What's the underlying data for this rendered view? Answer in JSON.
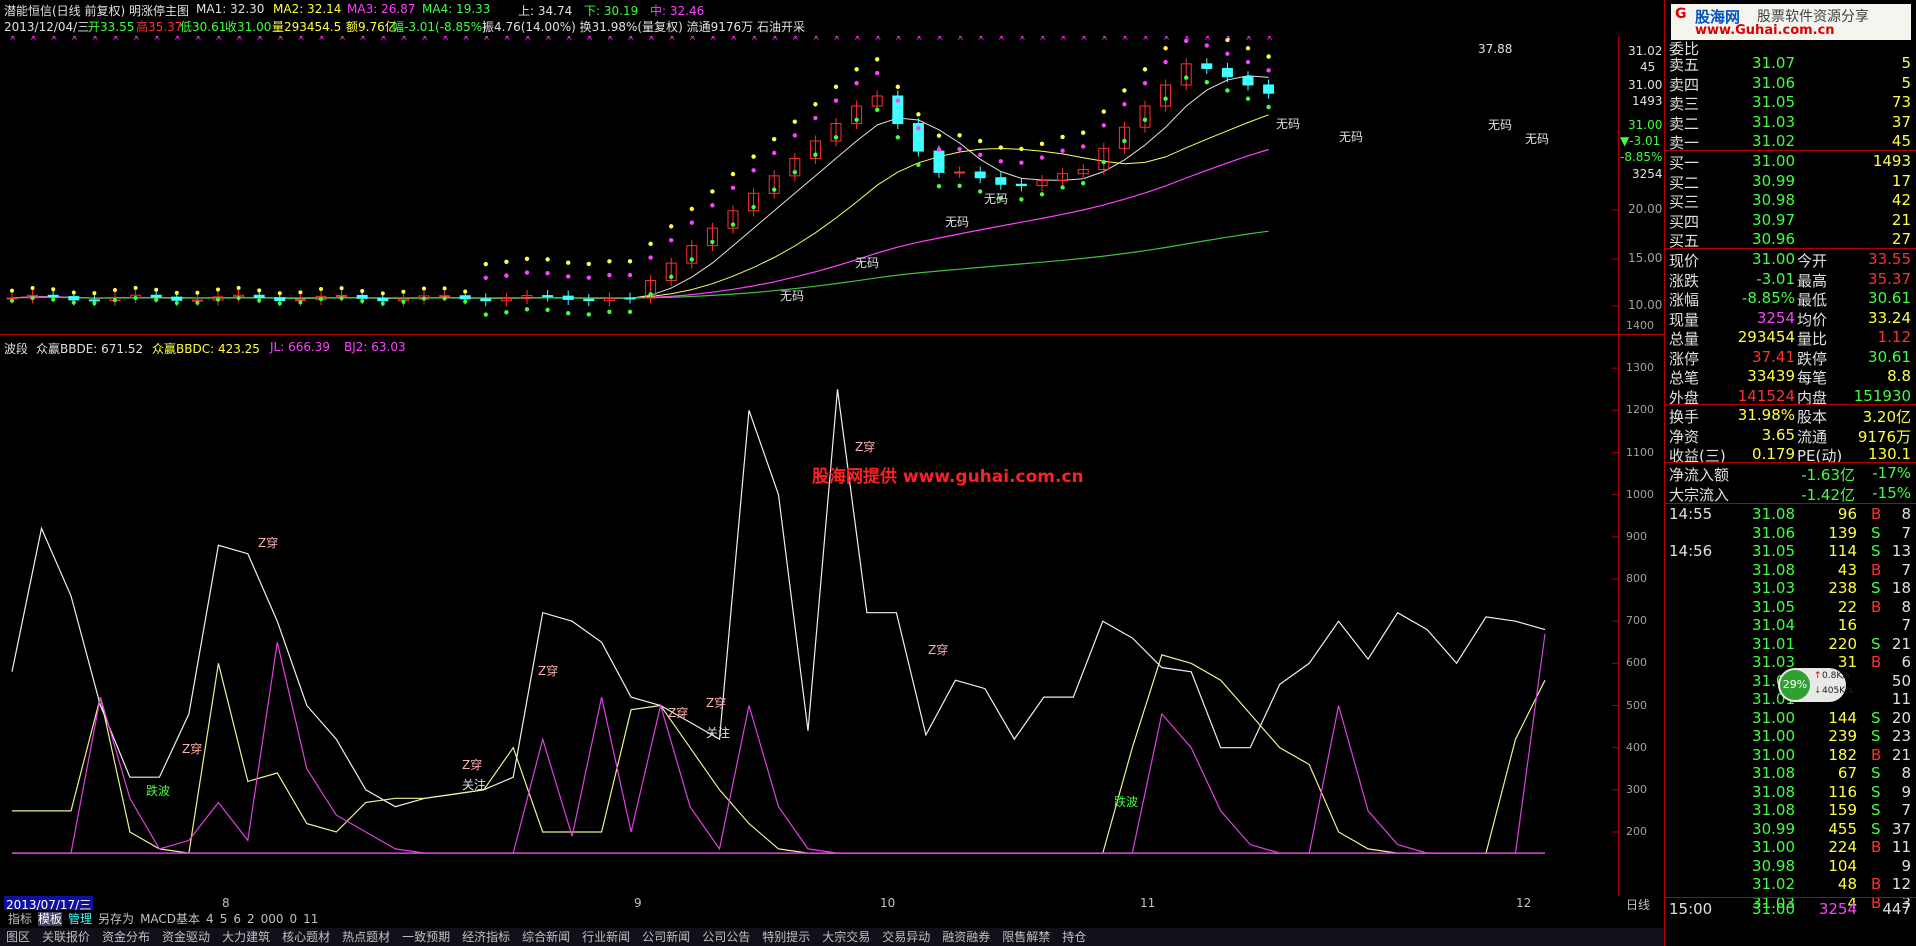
{
  "header": {
    "title": "潜能恒信(日线 前复权) 明涨停主图",
    "ma1": "MA1: 32.30",
    "ma2": "MA2: 32.14",
    "ma3": "MA3: 26.87",
    "ma4": "MA4: 19.33",
    "up": "上: 34.74",
    "down": "下: 30.19",
    "mid": "中: 32.46",
    "info_line": "2013/12/04/三",
    "open": "开33.55",
    "high": "高35.37",
    "low": "低30.61",
    "close": "收31.00",
    "vol": "量293454.5",
    "amt": "额9.76亿",
    "chg": "幅-3.01(-8.85%)",
    "extra": "振4.76(14.00%) 换31.98%(量复权) 流通9176万 石油开采"
  },
  "main_chart": {
    "price_labels": [
      "31.02",
      "45",
      "31.00",
      "1493",
      "31.00",
      "▼-3.01",
      "-8.85%",
      "3254",
      "20.00",
      "15.00",
      "10.00"
    ],
    "peak_label": "37.88",
    "annotations": [
      "无码",
      "无码",
      "无码",
      "无码",
      "无码",
      "无码",
      "无码",
      "无码"
    ]
  },
  "sub_chart": {
    "title": "波段",
    "bbde": "众赢BBDE: 671.52",
    "bbdc": "众赢BBDC: 423.25",
    "jl": "JL: 666.39",
    "bj2": "BJ2: 63.03",
    "y_labels": [
      "1400",
      "1300",
      "1200",
      "1100",
      "1000",
      "900",
      "800",
      "700",
      "600",
      "500",
      "400",
      "300",
      "200"
    ],
    "watermark": "股海网提供 www.guhai.com.cn",
    "marks": {
      "z": "Z穿",
      "focus": "关注",
      "drop": "跌波"
    },
    "chart_data": {
      "type": "line",
      "series": [
        {
          "values": [
            580,
            920,
            760,
            500,
            330,
            330,
            480,
            880,
            860,
            700,
            500,
            420,
            300,
            260,
            280,
            290,
            300,
            330,
            720,
            700,
            650,
            520,
            500,
            460,
            420,
            1200,
            1000,
            440,
            1250,
            720,
            720,
            430,
            560,
            540,
            420,
            520,
            520,
            700,
            660,
            590,
            580,
            400,
            400,
            550,
            600,
            700,
            610,
            720,
            680,
            600,
            710,
            700,
            680
          ]
        },
        {
          "values": [
            250,
            250,
            250,
            520,
            200,
            160,
            150,
            600,
            320,
            340,
            220,
            200,
            270,
            280,
            280,
            290,
            300,
            400,
            200,
            200,
            200,
            490,
            500,
            400,
            300,
            220,
            160,
            150,
            150,
            150,
            150,
            150,
            150,
            150,
            150,
            150,
            150,
            150,
            400,
            620,
            600,
            560,
            480,
            400,
            360,
            200,
            160,
            150,
            150,
            150,
            150,
            420,
            560
          ]
        },
        {
          "values": [
            150,
            150,
            150,
            520,
            280,
            160,
            180,
            270,
            180,
            650,
            350,
            240,
            200,
            160,
            150,
            150,
            150,
            150,
            420,
            190,
            520,
            200,
            500,
            260,
            160,
            500,
            260,
            160,
            150,
            150,
            150,
            150,
            150,
            150,
            150,
            150,
            150,
            150,
            150,
            480,
            400,
            250,
            170,
            150,
            150,
            500,
            250,
            170,
            150,
            150,
            150,
            150,
            670
          ]
        }
      ]
    }
  },
  "x_axis": {
    "date": "2013/07/17/三",
    "ticks": [
      "8",
      "9",
      "10",
      "11",
      "12"
    ],
    "period": "日线"
  },
  "toolbar": {
    "items": [
      "指标",
      "模板",
      "管理",
      "另存为",
      "MACD基本",
      "4",
      "5",
      "6",
      "2",
      "000",
      "0",
      "11"
    ]
  },
  "bottom_bar": {
    "items": [
      "图区",
      "关联报价",
      "资金分布",
      "资金驱动",
      "大力建筑",
      "核心题材",
      "热点题材",
      "一致预期",
      "经济指标",
      "综合新闻",
      "行业新闻",
      "公司新闻",
      "公司公告",
      "特别提示",
      "大宗交易",
      "交易异动",
      "融资融券",
      "限售解禁",
      "持仓"
    ]
  },
  "right_panel": {
    "logo_text": "股海网",
    "logo_sub": "股票软件资源分享",
    "logo_url": "www.Guhai.com.cn",
    "wei_bi": "委比",
    "asks": [
      {
        "label": "卖五",
        "price": "31.07",
        "vol": "5"
      },
      {
        "label": "卖四",
        "price": "31.06",
        "vol": "5"
      },
      {
        "label": "卖三",
        "price": "31.05",
        "vol": "73"
      },
      {
        "label": "卖二",
        "price": "31.03",
        "vol": "37"
      },
      {
        "label": "卖一",
        "price": "31.02",
        "vol": "45"
      }
    ],
    "bids": [
      {
        "label": "买一",
        "price": "31.00",
        "vol": "1493"
      },
      {
        "label": "买二",
        "price": "30.99",
        "vol": "17"
      },
      {
        "label": "买三",
        "price": "30.98",
        "vol": "42"
      },
      {
        "label": "买四",
        "price": "30.97",
        "vol": "21"
      },
      {
        "label": "买五",
        "price": "30.96",
        "vol": "27"
      }
    ],
    "stats": [
      {
        "l1": "现价",
        "v1": "31.00",
        "l2": "今开",
        "v2": "33.55"
      },
      {
        "l1": "涨跌",
        "v1": "-3.01",
        "l2": "最高",
        "v2": "35.37"
      },
      {
        "l1": "涨幅",
        "v1": "-8.85%",
        "l2": "最低",
        "v2": "30.61"
      },
      {
        "l1": "现量",
        "v1": "3254",
        "l2": "均价",
        "v2": "33.24"
      },
      {
        "l1": "总量",
        "v1": "293454",
        "l2": "量比",
        "v2": "1.12"
      },
      {
        "l1": "涨停",
        "v1": "37.41",
        "l2": "跌停",
        "v2": "30.61"
      },
      {
        "l1": "总笔",
        "v1": "33439",
        "l2": "每笔",
        "v2": "8.8"
      },
      {
        "l1": "外盘",
        "v1": "141524",
        "l2": "内盘",
        "v2": "151930"
      }
    ],
    "stats2": [
      {
        "l1": "换手",
        "v1": "31.98%",
        "l2": "股本",
        "v2": "3.20亿"
      },
      {
        "l1": "净资",
        "v1": "3.65",
        "l2": "流通",
        "v2": "9176万"
      },
      {
        "l1": "收益(三)",
        "v1": "0.179",
        "l2": "PE(动)",
        "v2": "130.1"
      }
    ],
    "flow": [
      {
        "label": "净流入额",
        "v1": "-1.63亿",
        "v2": "-17%"
      },
      {
        "label": "大宗流入",
        "v1": "-1.42亿",
        "v2": "-15%"
      }
    ],
    "ticks": [
      {
        "time": "14:55",
        "price": "31.08",
        "vol": "96",
        "bs": "B",
        "n": "8"
      },
      {
        "time": "",
        "price": "31.06",
        "vol": "139",
        "bs": "S",
        "n": "7"
      },
      {
        "time": "14:56",
        "price": "31.05",
        "vol": "114",
        "bs": "S",
        "n": "13"
      },
      {
        "time": "",
        "price": "31.08",
        "vol": "43",
        "bs": "B",
        "n": "7"
      },
      {
        "time": "",
        "price": "31.03",
        "vol": "238",
        "bs": "S",
        "n": "18"
      },
      {
        "time": "",
        "price": "31.05",
        "vol": "22",
        "bs": "B",
        "n": "8"
      },
      {
        "time": "",
        "price": "31.04",
        "vol": "16",
        "bs": "",
        "n": "7"
      },
      {
        "time": "",
        "price": "31.01",
        "vol": "220",
        "bs": "S",
        "n": "21"
      },
      {
        "time": "",
        "price": "31.03",
        "vol": "31",
        "bs": "B",
        "n": "6"
      },
      {
        "time": "",
        "price": "31.02",
        "vol": "",
        "bs": "",
        "n": "50"
      },
      {
        "time": "",
        "price": "31.01",
        "vol": "",
        "bs": "",
        "n": "11"
      },
      {
        "time": "",
        "price": "31.00",
        "vol": "144",
        "bs": "S",
        "n": "20"
      },
      {
        "time": "",
        "price": "31.00",
        "vol": "239",
        "bs": "S",
        "n": "23"
      },
      {
        "time": "",
        "price": "31.00",
        "vol": "182",
        "bs": "B",
        "n": "21"
      },
      {
        "time": "",
        "price": "31.08",
        "vol": "67",
        "bs": "S",
        "n": "8"
      },
      {
        "time": "",
        "price": "31.08",
        "vol": "116",
        "bs": "S",
        "n": "9"
      },
      {
        "time": "",
        "price": "31.08",
        "vol": "159",
        "bs": "S",
        "n": "7"
      },
      {
        "time": "",
        "price": "30.99",
        "vol": "455",
        "bs": "S",
        "n": "37"
      },
      {
        "time": "",
        "price": "31.00",
        "vol": "224",
        "bs": "B",
        "n": "11"
      },
      {
        "time": "",
        "price": "30.98",
        "vol": "104",
        "bs": "",
        "n": "9"
      },
      {
        "time": "",
        "price": "31.02",
        "vol": "48",
        "bs": "B",
        "n": "12"
      },
      {
        "time": "",
        "price": "31.03",
        "vol": "4",
        "bs": "B",
        "n": "3"
      }
    ],
    "last_tick": {
      "time": "15:00",
      "price": "31.00",
      "vol": "3254",
      "n": "447"
    },
    "badge_pct": "29%",
    "badge_up": "0.8K/s",
    "badge_down": "405K/s"
  }
}
